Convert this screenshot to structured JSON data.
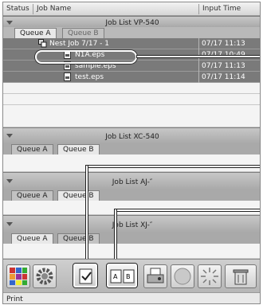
{
  "columns": {
    "status": "Status",
    "job_name": "Job Name",
    "input_time": "Input Time"
  },
  "groups": [
    {
      "title": "Job List VP-540",
      "tabs": [
        "Queue A",
        "Queue B"
      ],
      "active_tab": 0
    },
    {
      "title": "Job List XC-540",
      "tabs": [
        "Queue A",
        "Queue B"
      ],
      "active_tab": 1
    },
    {
      "title": "Job List AJ-″",
      "tabs": [
        "Queue A",
        "Queue B"
      ],
      "active_tab": 1
    },
    {
      "title": "Job List XJ-″",
      "tabs": [
        "Queue A",
        "Queue B"
      ],
      "active_tab": 0
    }
  ],
  "jobs": [
    {
      "name": "Nest Job 7/17 - 1",
      "time": "07/17 11:13",
      "icon": "nest-job-icon"
    },
    {
      "name": "N1A.eps",
      "time": "07/17 10:49",
      "icon": "file-icon"
    },
    {
      "name": "sample.eps",
      "time": "07/17 11:13",
      "icon": "file-icon"
    },
    {
      "name": "test.eps",
      "time": "07/17 11:14",
      "icon": "file-icon"
    }
  ],
  "toolbar": {
    "icons": [
      "grid-color-icon",
      "gear-icon",
      "check-card-icon",
      "ab-copy-icon",
      "printer-icon",
      "circle-icon",
      "burst-icon",
      "trash-icon"
    ]
  },
  "status_bar": {
    "text": "Print"
  },
  "colors": {
    "selection": "#7a7a7a",
    "band": "#b5b5b5",
    "highlight": "#ffffff"
  }
}
